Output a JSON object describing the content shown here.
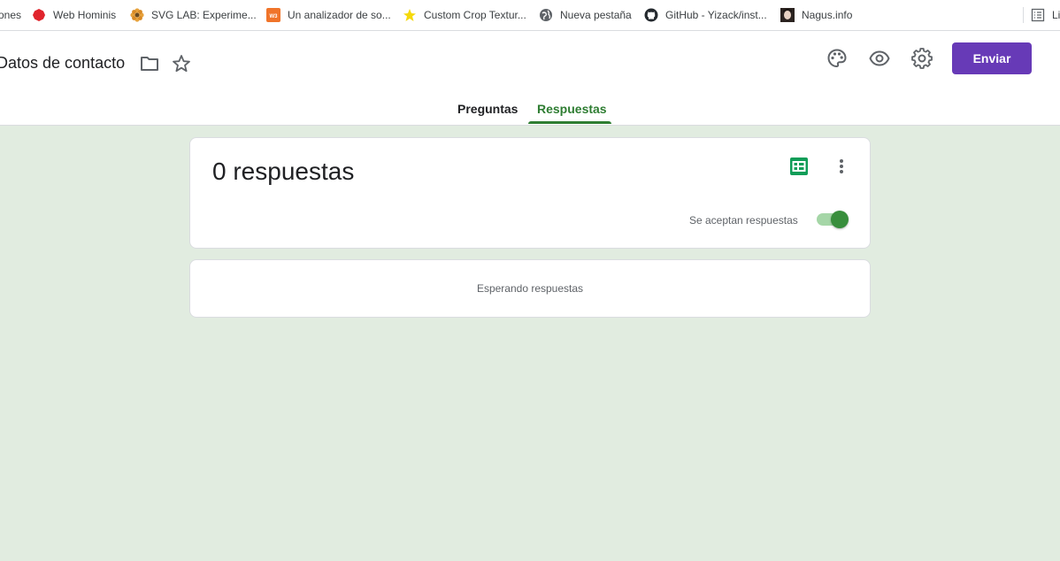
{
  "bookmarks": [
    {
      "label": "ones",
      "icon": "none"
    },
    {
      "label": "Web Hominis",
      "icon": "red-circle-icon"
    },
    {
      "label": "SVG LAB: Experime...",
      "icon": "flower-icon"
    },
    {
      "label": "Un analizador de so...",
      "icon": "w3-icon"
    },
    {
      "label": "Custom Crop Textur...",
      "icon": "yellow-star-icon"
    },
    {
      "label": "Nueva pestaña",
      "icon": "globe-icon"
    },
    {
      "label": "GitHub - Yizack/inst...",
      "icon": "github-icon"
    },
    {
      "label": "Nagus.info",
      "icon": "avatar-icon"
    },
    {
      "label": "Lis",
      "icon": "reading-list-icon"
    }
  ],
  "header": {
    "title": "Datos de contacto",
    "send_label": "Enviar",
    "icons": [
      "folder-icon",
      "star-icon",
      "palette-icon",
      "eye-icon",
      "gear-icon"
    ]
  },
  "tabs": [
    {
      "label": "Preguntas",
      "active": false
    },
    {
      "label": "Respuestas",
      "active": true
    }
  ],
  "summary": {
    "count_text": "0 respuestas",
    "accepting_label": "Se aceptan respuestas",
    "accepting": true
  },
  "waiting": {
    "text": "Esperando respuestas"
  },
  "colors": {
    "accent_purple": "#673ab7",
    "active_green": "#2e7d32",
    "background": "#e1ece0",
    "sheets_green": "#0f9d58"
  }
}
